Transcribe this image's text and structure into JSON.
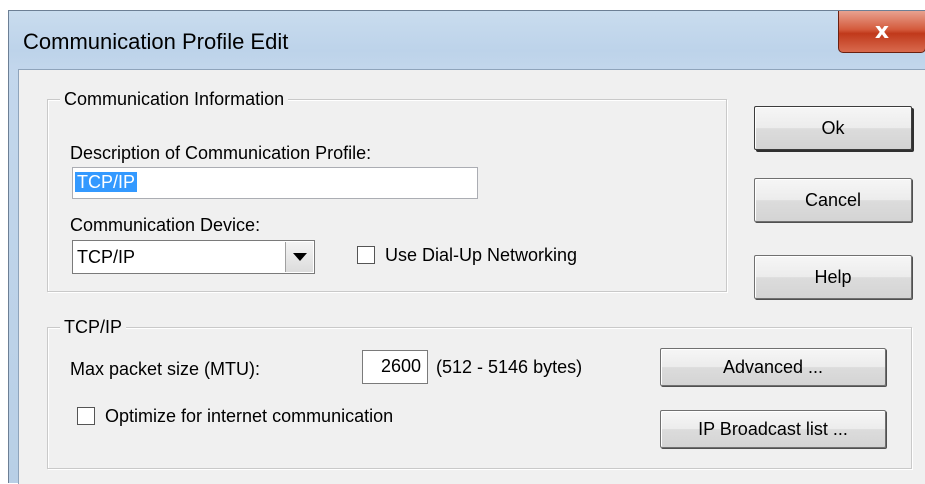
{
  "window": {
    "title": "Communication Profile Edit",
    "close_symbol": "x"
  },
  "comm_info": {
    "legend": "Communication Information",
    "description_label": "Description of Communication Profile:",
    "description_value": "TCP/IP",
    "device_label": "Communication Device:",
    "device_value": "TCP/IP",
    "dialup_label": "Use Dial-Up Networking",
    "dialup_checked": false
  },
  "tcpip": {
    "legend": "TCP/IP",
    "mtu_label": "Max packet size (MTU):",
    "mtu_value": "2600",
    "mtu_range": "(512 - 5146 bytes)",
    "optimize_label": "Optimize for internet communication",
    "optimize_checked": false
  },
  "buttons": {
    "ok": "Ok",
    "cancel": "Cancel",
    "help": "Help",
    "advanced": "Advanced ...",
    "ip_broadcast": "IP Broadcast list ..."
  },
  "icons": {
    "close": "close-icon",
    "dropdown": "chevron-down-icon"
  },
  "colors": {
    "titlebar": "#bdd3ea",
    "client": "#f0f0f0",
    "close_button": "#c0391b",
    "selection": "#3399ff"
  }
}
